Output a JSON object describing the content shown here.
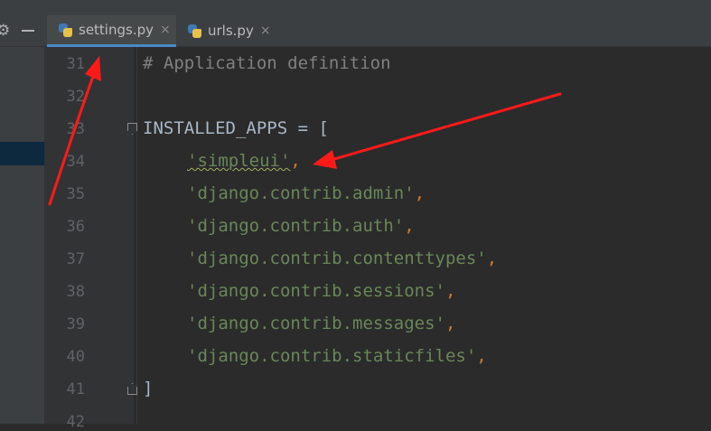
{
  "tabs": [
    {
      "name": "settings.py",
      "active": true
    },
    {
      "name": "urls.py",
      "active": false
    }
  ],
  "toolbar": {
    "gear_icon": "gear-icon",
    "minimize_icon": "minimize-icon"
  },
  "tab_close_glyph": "×",
  "editor": {
    "line_numbers": [
      "31",
      "32",
      "33",
      "34",
      "35",
      "36",
      "37",
      "38",
      "39",
      "40",
      "41",
      "42"
    ],
    "lines": {
      "l31": "# Application definition",
      "l33_name": "INSTALLED_APPS = [",
      "l34_str": "'simpleui'",
      "l35_str": "'django.contrib.admin'",
      "l36_str": "'django.contrib.auth'",
      "l37_str": "'django.contrib.contenttypes'",
      "l38_str": "'django.contrib.sessions'",
      "l39_str": "'django.contrib.messages'",
      "l40_str": "'django.contrib.staticfiles'",
      "l41": "]",
      "comma": ","
    }
  },
  "colors": {
    "editor_bg": "#2b2b2b",
    "gutter_bg": "#313335",
    "string": "#6a8759",
    "punctuation": "#cc7832",
    "comment": "#808080",
    "arrow": "#ff1a1a"
  }
}
